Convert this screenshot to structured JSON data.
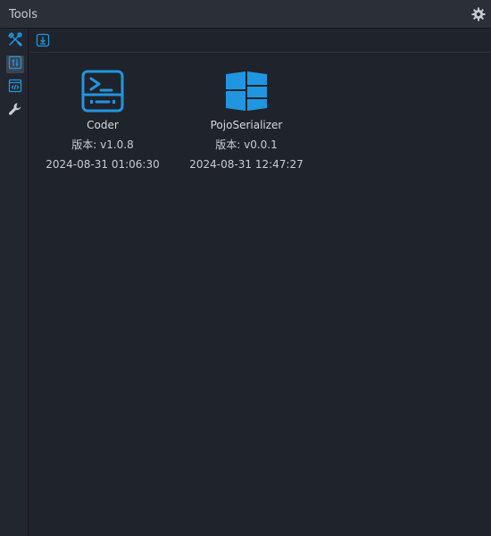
{
  "panel": {
    "title": "Tools",
    "settings_icon": "gear-icon"
  },
  "sidebar": {
    "items": [
      {
        "icon": "tools-icon",
        "active": false
      },
      {
        "icon": "sliders-icon",
        "active": true
      },
      {
        "icon": "code-window-icon",
        "active": false
      },
      {
        "icon": "wrench-icon",
        "active": false
      }
    ]
  },
  "toolbar": {
    "import_icon": "download-box-icon"
  },
  "tools": [
    {
      "name": "Coder",
      "version": "版本: v1.0.8",
      "date": "2024-08-31 01:06:30",
      "icon": "terminal-icon"
    },
    {
      "name": "PojoSerializer",
      "version": "版本: v0.0.1",
      "date": "2024-08-31 12:47:27",
      "icon": "grid-logo-icon"
    }
  ],
  "colors": {
    "accent": "#2196e0",
    "background": "#1f232b",
    "titlebar": "#2b2f38",
    "text": "#c8ccd2"
  }
}
